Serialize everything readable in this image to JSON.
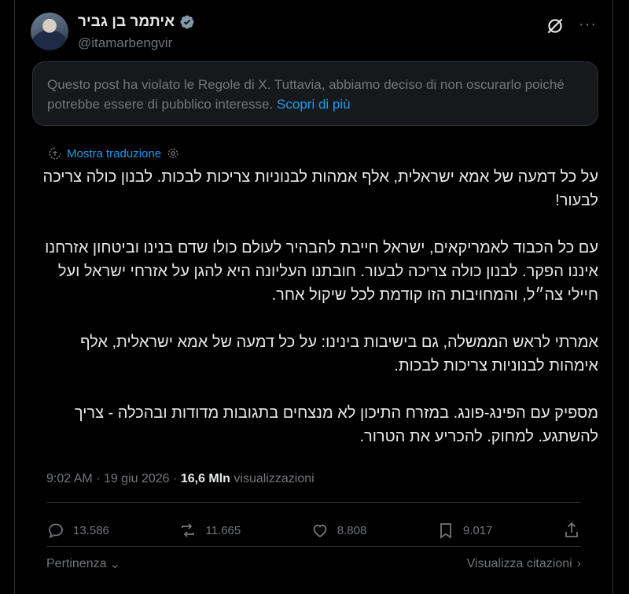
{
  "author": {
    "name": "איתמר בן גביר",
    "handle": "@itamarbengvir"
  },
  "notice": {
    "text": "Questo post ha violato le Regole di X. Tuttavia, abbiamo deciso di non oscurarlo poiché potrebbe essere di pubblico interesse.",
    "link": "Scopri di più"
  },
  "translate_label": "Mostra traduzione",
  "post": {
    "paragraphs": [
      "על כל דמעה של אמא ישראלית, אלף אמהות לבנוניות צריכות לבכות. לבנון כולה צריכה לבעור!",
      "עם כל הכבוד לאמריקאים, ישראל חייבת להבהיר לעולם כולו שדם בנינו וביטחון אזרחנו איננו הפקר. לבנון כולה צריכה לבעור. חובתנו העליונה היא להגן על אזרחי ישראל ועל חיילי צה״ל, והמחויבות הזו קודמת לכל שיקול אחר.",
      "אמרתי לראש הממשלה, גם בישיבות בינינו: על כל דמעה של אמא ישראלית, אלף אימהות לבנוניות צריכות לבכות.",
      "מספיק עם הפינג-פונג. במזרח התיכון לא מנצחים בתגובות מדודות ובהכלה - צריך להשתגע. למחוק. להכריע את הטרור."
    ]
  },
  "meta": {
    "time": "9:02 AM",
    "sep": "·",
    "date": "19 giu 2026",
    "views_count": "16,6 Mln",
    "views_label": "visualizzazioni"
  },
  "actions": {
    "replies": "13.586",
    "reposts": "11.665",
    "likes": "8.808",
    "bookmarks": "9.017"
  },
  "footer": {
    "sort": "Pertinenza",
    "quotes": "Visualizza citazioni"
  },
  "colors": {
    "accent": "#1d9bf0",
    "muted": "#71767b",
    "text": "#e7e9ea",
    "background": "#000000"
  }
}
